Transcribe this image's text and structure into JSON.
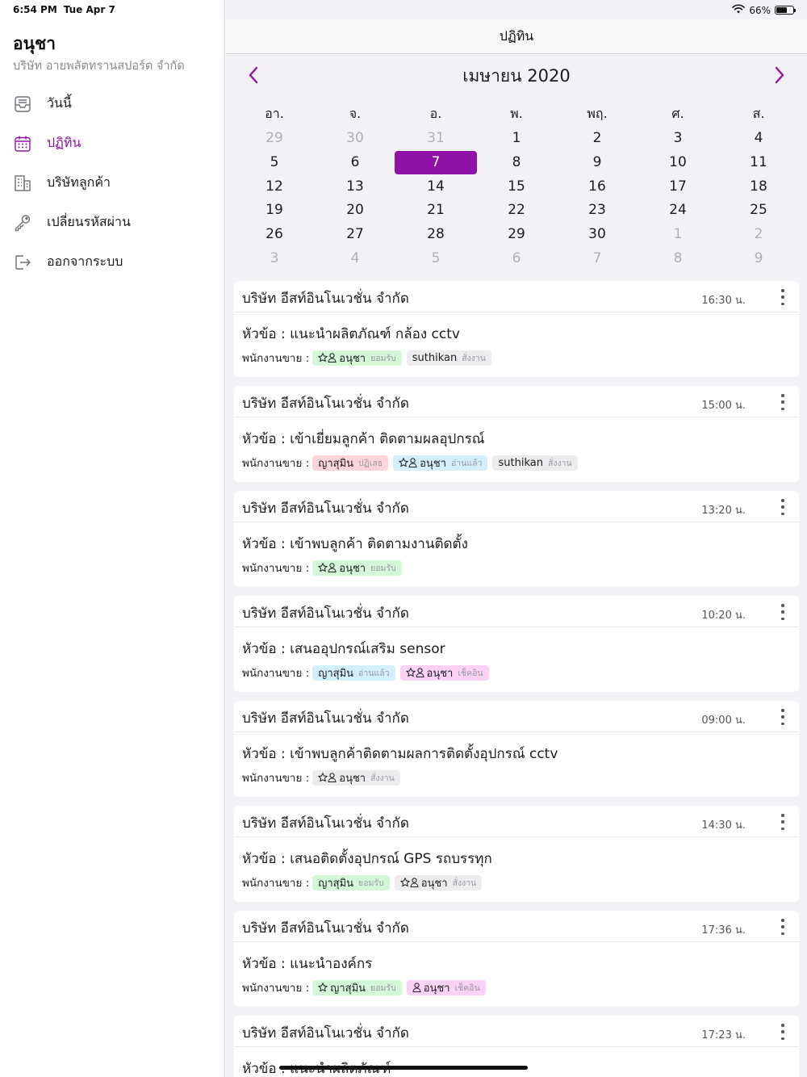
{
  "status_bar": {
    "time": "6:54 PM",
    "date": "Tue Apr 7",
    "battery": "66%"
  },
  "sidebar": {
    "user_name": "อนุชา",
    "company": "บริษัท อายพลัตทรานสปอร์ต จำกัด",
    "items": [
      {
        "label": "วันนี้",
        "icon": "inbox-icon",
        "active": false
      },
      {
        "label": "ปฏิทิน",
        "icon": "calendar-icon",
        "active": true
      },
      {
        "label": "บริษัทลูกค้า",
        "icon": "building-icon",
        "active": false
      },
      {
        "label": "เปลี่ยนรหัสผ่าน",
        "icon": "key-icon",
        "active": false
      },
      {
        "label": "ออกจากระบบ",
        "icon": "logout-icon",
        "active": false
      }
    ]
  },
  "header": {
    "title": "ปฏิทิน"
  },
  "calendar": {
    "month_title": "เมษายน 2020",
    "weekdays": [
      "อา.",
      "จ.",
      "อ.",
      "พ.",
      "พฤ.",
      "ศ.",
      "ส."
    ],
    "weeks": [
      [
        "29",
        "30",
        "31",
        "1",
        "2",
        "3",
        "4"
      ],
      [
        "5",
        "6",
        "7",
        "8",
        "9",
        "10",
        "11"
      ],
      [
        "12",
        "13",
        "14",
        "15",
        "16",
        "17",
        "18"
      ],
      [
        "19",
        "20",
        "21",
        "22",
        "23",
        "24",
        "25"
      ],
      [
        "26",
        "27",
        "28",
        "29",
        "30",
        "1",
        "2"
      ],
      [
        "3",
        "4",
        "5",
        "6",
        "7",
        "8",
        "9"
      ]
    ],
    "selected_day": "7",
    "accent_color": "#9013a8"
  },
  "staff_label": "พนักงานขาย :",
  "topic_prefix": "หัวข้อ : ",
  "appointments": [
    {
      "company": "บริษัท อีสท์อินโนเวชั่น จำกัด",
      "time": "16:30 น.",
      "topic": "แนะนำผลิตภัณฑ์ กล้อง cctv",
      "staff": [
        {
          "name": "อนุชา",
          "status": "ยอมรับ",
          "color": "green",
          "star": true,
          "person": true
        },
        {
          "name": "suthikan",
          "status": "สั่งงาน",
          "color": "gray",
          "star": false,
          "person": false
        }
      ]
    },
    {
      "company": "บริษัท อีสท์อินโนเวชั่น จำกัด",
      "time": "15:00 น.",
      "topic": "เข้าเยี่ยมลูกค้า ติดตามผลอุปกรณ์",
      "staff": [
        {
          "name": "ญาสุมิน",
          "status": "ปฏิเสธ",
          "color": "red",
          "star": false,
          "person": false
        },
        {
          "name": "อนุชา",
          "status": "อ่านแล้ว",
          "color": "blue",
          "star": true,
          "person": true
        },
        {
          "name": "suthikan",
          "status": "สั่งงาน",
          "color": "gray",
          "star": false,
          "person": false
        }
      ]
    },
    {
      "company": "บริษัท อีสท์อินโนเวชั่น จำกัด",
      "time": "13:20 น.",
      "topic": "เข้าพบลูกค้า ติดตามงานติดตั้ง",
      "staff": [
        {
          "name": "อนุชา",
          "status": "ยอมรับ",
          "color": "green",
          "star": true,
          "person": true
        }
      ]
    },
    {
      "company": "บริษัท อีสท์อินโนเวชั่น จำกัด",
      "time": "10:20 น.",
      "topic": "เสนออุปกรณ์เสริม sensor",
      "staff": [
        {
          "name": "ญาสุมิน",
          "status": "อ่านแล้ว",
          "color": "blue",
          "star": false,
          "person": false
        },
        {
          "name": "อนุชา",
          "status": "เช็คอิน",
          "color": "pink",
          "star": true,
          "person": true
        }
      ]
    },
    {
      "company": "บริษัท อีสท์อินโนเวชั่น จำกัด",
      "time": "09:00 น.",
      "topic": "เข้าพบลูกค้าติดตามผลการติดตั้งอุปกรณ์ cctv",
      "staff": [
        {
          "name": "อนุชา",
          "status": "สั่งงาน",
          "color": "gray",
          "star": true,
          "person": true
        }
      ]
    },
    {
      "company": "บริษัท อีสท์อินโนเวชั่น จำกัด",
      "time": "14:30 น.",
      "topic": "เสนอติดตั้งอุปกรณ์ GPS รถบรรทุก",
      "staff": [
        {
          "name": "ญาสุมิน",
          "status": "ยอมรับ",
          "color": "green",
          "star": false,
          "person": false
        },
        {
          "name": "อนุชา",
          "status": "สั่งงาน",
          "color": "gray",
          "star": true,
          "person": true
        }
      ]
    },
    {
      "company": "บริษัท อีสท์อินโนเวชั่น จำกัด",
      "time": "17:36 น.",
      "topic": "แนะนำองค์กร",
      "staff": [
        {
          "name": "ญาสุมิน",
          "status": "ยอมรับ",
          "color": "green",
          "star": true,
          "person": false
        },
        {
          "name": "อนุชา",
          "status": "เช็คอิน",
          "color": "pink",
          "star": false,
          "person": true
        }
      ]
    },
    {
      "company": "บริษัท อีสท์อินโนเวชั่น จำกัด",
      "time": "17:23 น.",
      "topic": "แนะนำผลิตภัณฑ์",
      "staff": []
    }
  ]
}
